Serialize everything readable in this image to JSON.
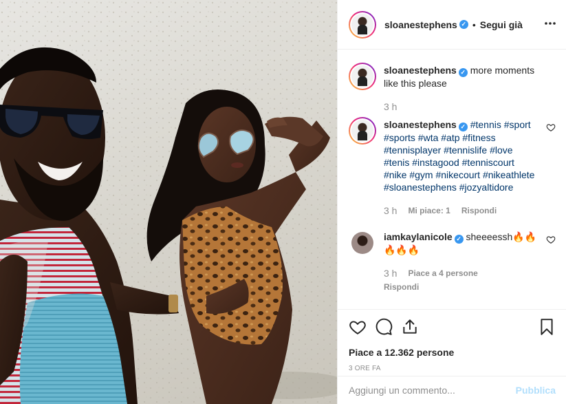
{
  "post": {
    "username": "sloanestephens",
    "verified_mark": "✓",
    "separator": "•",
    "follow_status": "Segui già",
    "more_icon": "more-horizontal-icon"
  },
  "comments": [
    {
      "username": "sloanestephens",
      "text": "more moments like this please",
      "time": "3 h"
    },
    {
      "username": "sloanestephens",
      "hashtags": "#tennis #sport #sports #wta #atp #fitness #tennisplayer #tennislife #love #tenis #instagood #tenniscourt #nike #gym #nikecourt #nikeathlete #sloanestephens #jozyaltidore",
      "time": "3 h",
      "likes": "Mi piace: 1",
      "reply": "Rispondi"
    },
    {
      "username": "iamkaylanicole",
      "text": "sheeeessh🔥🔥 🔥🔥🔥",
      "time": "3 h",
      "likes": "Piace a 4 persone",
      "reply": "Rispondi"
    }
  ],
  "actions": {
    "like_icon": "heart-icon",
    "comment_icon": "comment-icon",
    "share_icon": "share-icon",
    "save_icon": "bookmark-icon",
    "likes": "Piace a 12.362 persone",
    "posted": "3 ORE FA"
  },
  "composer": {
    "placeholder": "Aggiungi un commento...",
    "publish": "Pubblica"
  },
  "colors": {
    "accent": "#3897f0",
    "hashtag": "#003569",
    "publish_disabled": "#b2dffc",
    "muted": "#8e8e8e"
  }
}
